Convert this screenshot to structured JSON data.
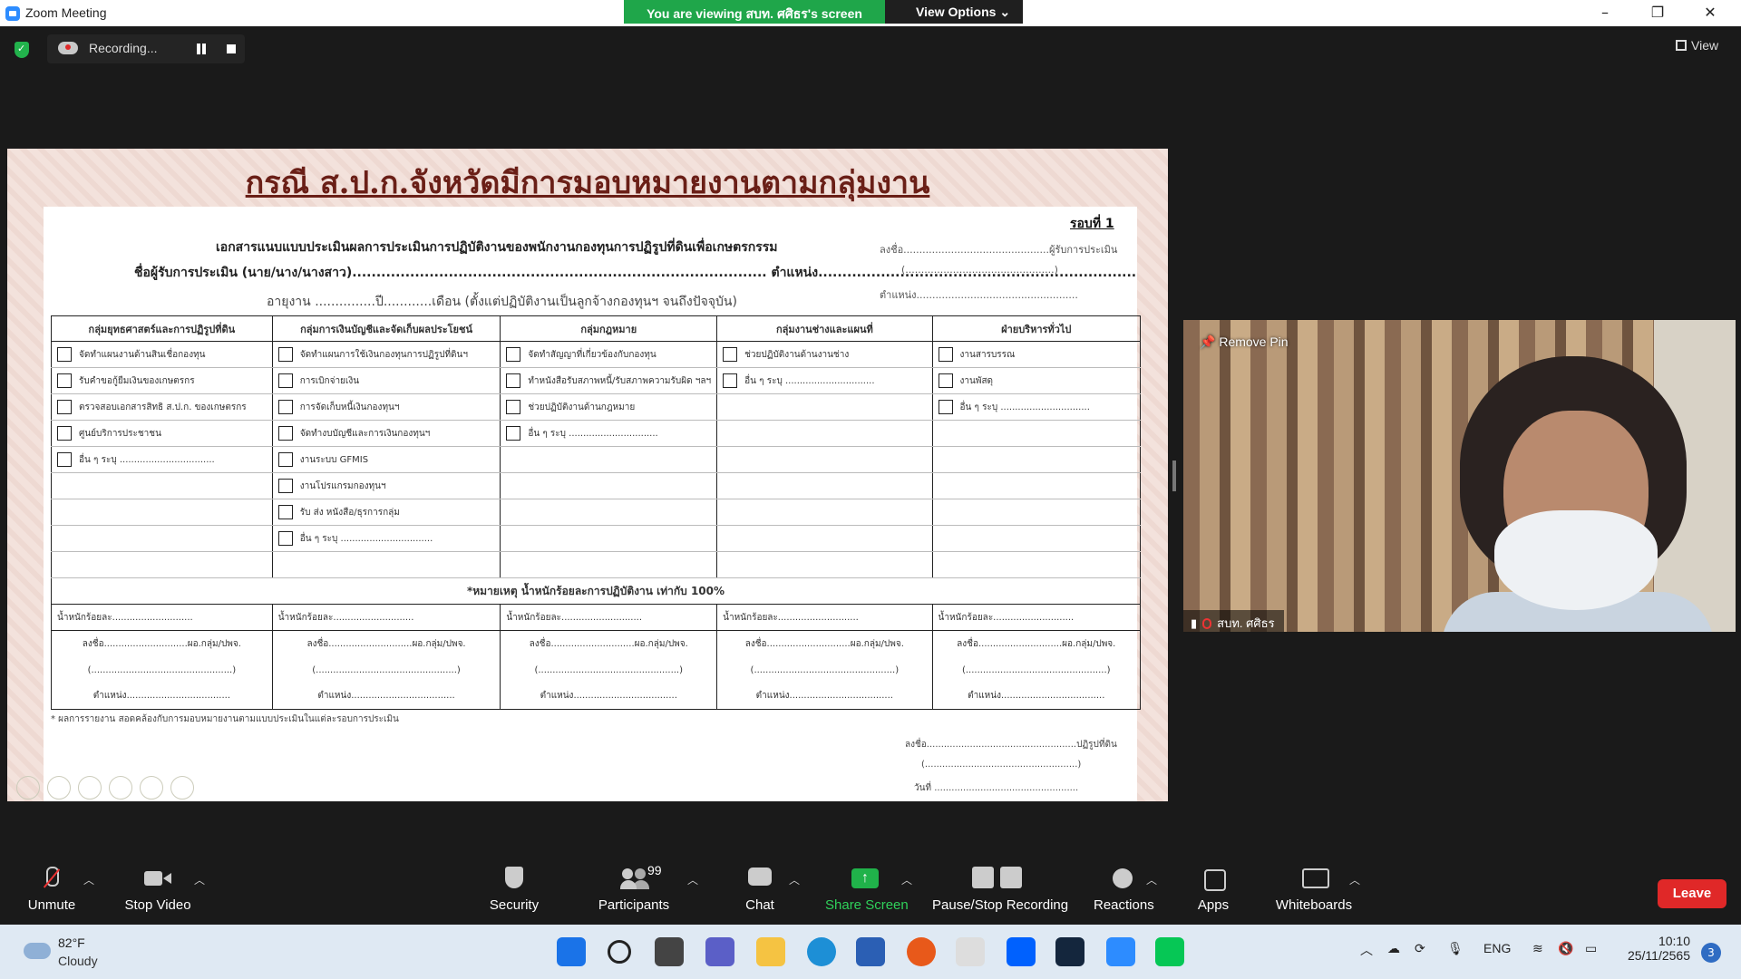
{
  "window": {
    "title": "Zoom Meeting"
  },
  "banner": {
    "viewing": "You are viewing สบท. ศศิธร's screen",
    "view_options": "View Options ⌄"
  },
  "recording": {
    "label": "Recording..."
  },
  "top_right": {
    "view_label": "View"
  },
  "slide": {
    "title": "กรณี ส.ป.ก.จังหวัดมีการมอบหมายงานตามกลุ่มงาน",
    "round": "รอบที่ 1",
    "heading": "เอกสารแนบแบบประเมินผลการประเมินการปฏิบัติงานของพนักงานกองทุนการปฏิรูปที่ดินเพื่อเกษตรกรรม",
    "evaluatee": "ชื่อผู้รับการประเมิน (นาย/นาง/นางสาว)...................................................................................... ตำแหน่ง..................................................................",
    "tenure": "อายุงาน ...............ปี............เดือน (ตั้งแต่ปฏิบัติงานเป็นลูกจ้างกองทุนฯ จนถึงปัจจุบัน)",
    "sign_right": [
      "ลงชื่อ..............................................ผู้รับการประเมิน",
      "(...............................................)",
      "ตำแหน่ง..................................................."
    ],
    "columns": [
      "กลุ่มยุทธศาสตร์และการปฏิรูปที่ดิน",
      "กลุ่มการเงินบัญชีและจัดเก็บผลประโยชน์",
      "กลุ่มกฎหมาย",
      "กลุ่มงานช่างและแผนที่",
      "ฝ่ายบริหารทั่วไป"
    ],
    "rows": [
      [
        "จัดทำแผนงานด้านสินเชื่อกองทุน",
        "จัดทำแผนการใช้เงินกองทุนการปฏิรูปที่ดินฯ",
        "จัดทำสัญญาที่เกี่ยวข้องกับกองทุน",
        "ช่วยปฏิบัติงานด้านงานช่าง",
        "งานสารบรรณ"
      ],
      [
        "รับคำขอกู้ยืมเงินของเกษตรกร",
        "การเบิกจ่ายเงิน",
        "ทำหนังสือรับสภาพหนี้/รับสภาพความรับผิด ฯลฯ",
        "อื่น ๆ ระบุ ...............................",
        "งานพัสดุ"
      ],
      [
        "ตรวจสอบเอกสารสิทธิ ส.ป.ก. ของเกษตรกร",
        "การจัดเก็บหนี้เงินกองทุนฯ",
        "ช่วยปฏิบัติงานด้านกฎหมาย",
        "",
        "อื่น ๆ ระบุ ..............................."
      ],
      [
        "ศูนย์บริการประชาชน",
        "จัดทำงบบัญชีและการเงินกองทุนฯ",
        "อื่น ๆ ระบุ ...............................",
        "",
        ""
      ],
      [
        "อื่น ๆ ระบุ .................................",
        "งานระบบ GFMIS",
        "",
        "",
        ""
      ],
      [
        "",
        "งานโปรแกรมกองทุนฯ",
        "",
        "",
        ""
      ],
      [
        "",
        "รับ ส่ง หนังสือ/ธุรการกลุ่ม",
        "",
        "",
        ""
      ],
      [
        "",
        "อื่น ๆ ระบุ ................................",
        "",
        "",
        ""
      ]
    ],
    "note": "*หมายเหตุ น้ำหนักร้อยละการปฏิบัติงาน เท่ากับ 100%",
    "weight_label": "น้ำหนักร้อยละ............................",
    "sig_label": "ลงชื่อ.............................ผอ.กลุ่ม/ปพจ.",
    "paren_label": "(.................................................)",
    "position_label": "ตำแหน่ง....................................",
    "footnote": "* ผลการรายงาน สอดคล้องกับการมอบหมายงานตามแบบประเมินในแต่ละรอบการประเมิน",
    "bottom_sign": [
      "ลงชื่อ....................................................ปฏิรูปที่ดิน",
      "(.....................................................)",
      "วันที่ .................................................."
    ]
  },
  "video": {
    "remove_pin": "Remove Pin",
    "participant_name": "สบท. ศศิธร"
  },
  "toolbar": {
    "unmute": "Unmute",
    "stop_video": "Stop Video",
    "security": "Security",
    "participants": "Participants",
    "participants_count": "99",
    "chat": "Chat",
    "share_screen": "Share Screen",
    "pause_stop": "Pause/Stop Recording",
    "reactions": "Reactions",
    "apps": "Apps",
    "whiteboards": "Whiteboards",
    "leave": "Leave"
  },
  "taskbar": {
    "temp": "82°F",
    "condition": "Cloudy",
    "lang": "ENG",
    "time": "10:10",
    "date": "25/11/2565",
    "notifications": "3"
  },
  "colors": {
    "share_green": "#1fa64a",
    "leave_red": "#e02828",
    "slide_title": "#6a1f17"
  }
}
